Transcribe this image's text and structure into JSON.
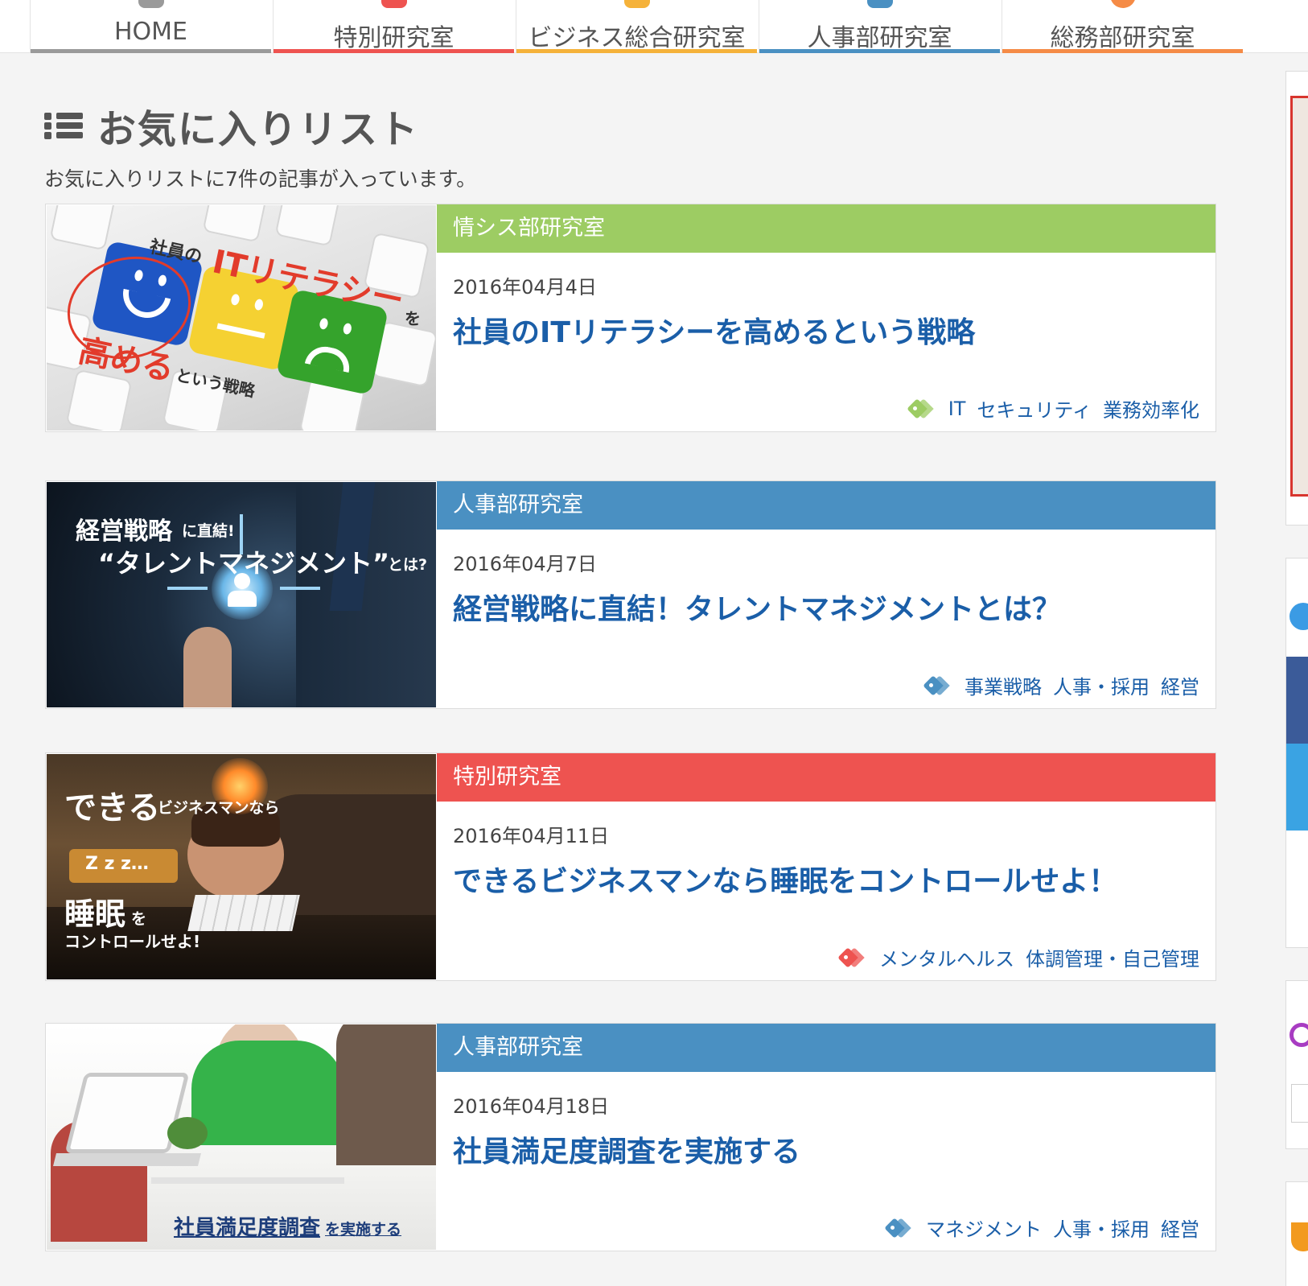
{
  "nav": {
    "items": [
      {
        "label": "HOME",
        "color": "#999999"
      },
      {
        "label": "特別研究室",
        "color": "#ee5350"
      },
      {
        "label": "ビジネス総合研究室",
        "color": "#f5b23a"
      },
      {
        "label": "人事部研究室",
        "color": "#4a90c2"
      },
      {
        "label": "総務部研究室",
        "color": "#f58b46"
      }
    ]
  },
  "page": {
    "title": "お気に入りリスト",
    "summary": "お気に入りリストに7件の記事が入っています。"
  },
  "cards": [
    {
      "category": "情シス部研究室",
      "category_color": "#9dcc63",
      "date": "2016年04月4日",
      "title": "社員のITリテラシーを高めるという戦略",
      "tag_color": "#9dcc63",
      "tags": [
        "IT",
        "セキュリティ",
        "業務効率化"
      ],
      "thumb_text": {
        "line1": "社員の",
        "line2": "ITリテラシー",
        "line3": "を",
        "line4": "高める",
        "line5": "という戦略"
      }
    },
    {
      "category": "人事部研究室",
      "category_color": "#4a90c2",
      "date": "2016年04月7日",
      "title": "経営戦略に直結！タレントマネジメントとは？",
      "tag_color": "#4a90c2",
      "tags": [
        "事業戦略",
        "人事・採用",
        "経営"
      ],
      "thumb_text": {
        "line1": "経営戦略",
        "line2": "に直結!",
        "line3": "“タレントマネジメント”",
        "line4": "とは?"
      }
    },
    {
      "category": "特別研究室",
      "category_color": "#ee5350",
      "date": "2016年04月11日",
      "title": "できるビジネスマンなら睡眠をコントロールせよ！",
      "tag_color": "#ee5350",
      "tags": [
        "メンタルヘルス",
        "体調管理・自己管理"
      ],
      "thumb_text": {
        "line1": "できる",
        "line2": "ビジネスマンなら",
        "line3": "Z z z…",
        "line4": "睡眠",
        "line5": "を",
        "line6": "コントロールせよ!"
      }
    },
    {
      "category": "人事部研究室",
      "category_color": "#4a90c2",
      "date": "2016年04月18日",
      "title": "社員満足度調査を実施する",
      "tag_color": "#4a90c2",
      "tags": [
        "マネジメント",
        "人事・採用",
        "経営"
      ],
      "thumb_text": {
        "line1": "社員満足度調査",
        "line2": "を実施する"
      }
    }
  ]
}
